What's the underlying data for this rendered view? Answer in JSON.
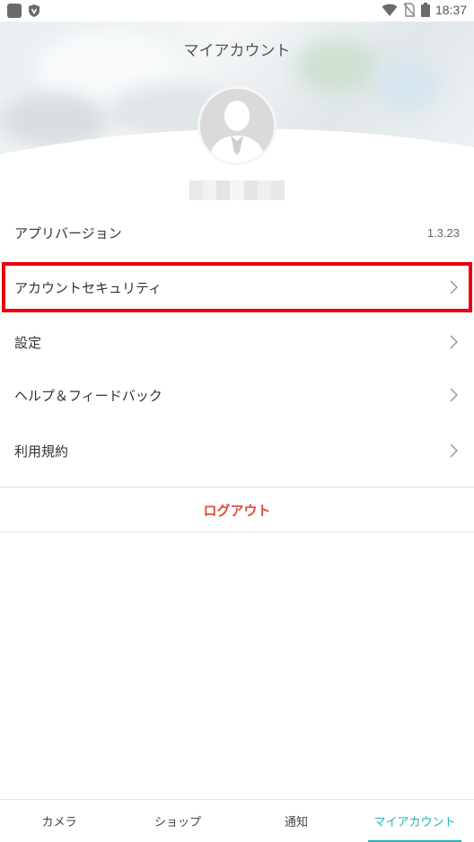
{
  "status_bar": {
    "time": "18:37",
    "icons": [
      "square-icon",
      "shield-icon",
      "wifi-icon",
      "no-sim-icon",
      "battery-icon"
    ]
  },
  "header": {
    "title": "マイアカウント"
  },
  "menu": {
    "items": [
      {
        "label": "アプリバージョン",
        "value": "1.3.23",
        "chevron": false
      },
      {
        "label": "アカウントセキュリティ",
        "chevron": true,
        "highlighted": true
      },
      {
        "label": "設定",
        "chevron": true
      },
      {
        "label": "ヘルプ＆フィードバック",
        "chevron": true
      },
      {
        "label": "利用規約",
        "chevron": true
      }
    ]
  },
  "logout_label": "ログアウト",
  "bottom_nav": {
    "items": [
      {
        "label": "カメラ"
      },
      {
        "label": "ショップ"
      },
      {
        "label": "通知"
      },
      {
        "label": "マイアカウント",
        "active": true
      }
    ]
  },
  "colors": {
    "accent": "#1fb6b4",
    "logout": "#e14b3b",
    "highlight_border": "#e8000b"
  }
}
